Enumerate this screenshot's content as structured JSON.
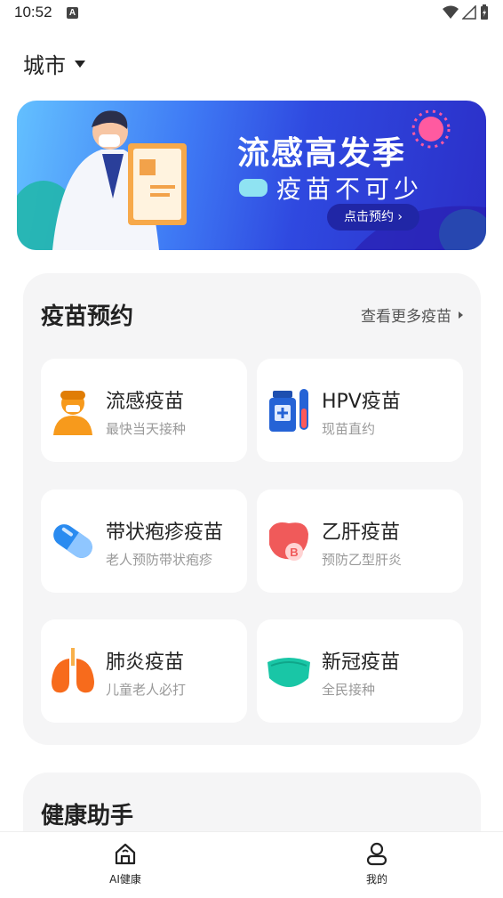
{
  "status_bar": {
    "time": "10:52",
    "notif_letter": "A"
  },
  "header": {
    "city_label": "城市"
  },
  "banner": {
    "title": "流感高发季",
    "subtitle": "疫苗不可少",
    "cta_label": "点击预约 ›"
  },
  "vaccine_section": {
    "title": "疫苗预约",
    "more_label": "查看更多疫苗",
    "items": [
      {
        "name": "流感疫苗",
        "desc": "最快当天接种",
        "icon": "doctor-icon"
      },
      {
        "name": "HPV疫苗",
        "desc": "现苗直约",
        "icon": "vaccine-vial-icon"
      },
      {
        "name": "带状疱疹疫苗",
        "desc": "老人预防带状疱疹",
        "icon": "capsule-icon"
      },
      {
        "name": "乙肝疫苗",
        "desc": "预防乙型肝炎",
        "icon": "liver-icon"
      },
      {
        "name": "肺炎疫苗",
        "desc": "儿童老人必打",
        "icon": "lungs-icon"
      },
      {
        "name": "新冠疫苗",
        "desc": "全民接种",
        "icon": "face-mask-icon"
      }
    ]
  },
  "health_section": {
    "title": "健康助手"
  },
  "tabbar": {
    "tabs": [
      {
        "label": "AI健康",
        "icon": "home-icon"
      },
      {
        "label": "我的",
        "icon": "user-icon"
      }
    ]
  },
  "colors": {
    "accent_blue": "#2f49e0",
    "card_bg": "#f5f5f6",
    "flu_orange": "#f79a1c",
    "hpv_blue": "#2563d6",
    "capsule_blue": "#2a8bf0",
    "liver_red": "#f05a5a",
    "lungs_orange": "#f76b1c",
    "mask_teal": "#19c6a6"
  }
}
